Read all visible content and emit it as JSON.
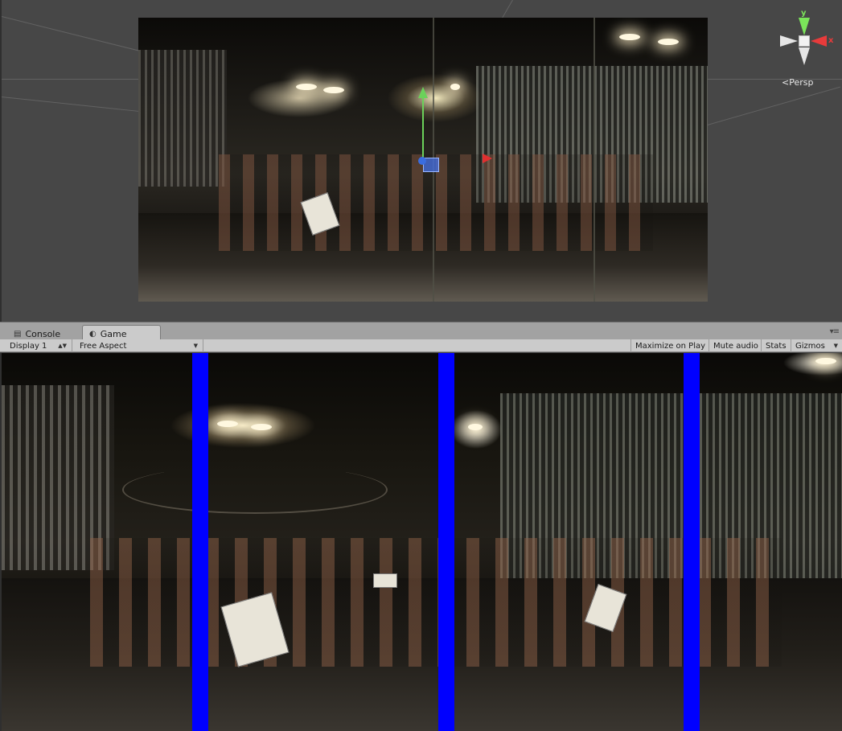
{
  "scene": {
    "projection_label": "Persp",
    "axis_labels": {
      "y": "y",
      "x": "x"
    }
  },
  "tabs": [
    {
      "label": "Console",
      "icon": "console-icon",
      "active": false
    },
    {
      "label": "Game",
      "icon": "game-icon",
      "active": true
    }
  ],
  "toolbar": {
    "display_select": "Display 1",
    "aspect_select": "Free Aspect",
    "maximize_on_play": "Maximize on Play",
    "mute_audio": "Mute audio",
    "stats": "Stats",
    "gizmos": "Gizmos"
  },
  "game": {
    "separator_color": "#0000ff"
  }
}
